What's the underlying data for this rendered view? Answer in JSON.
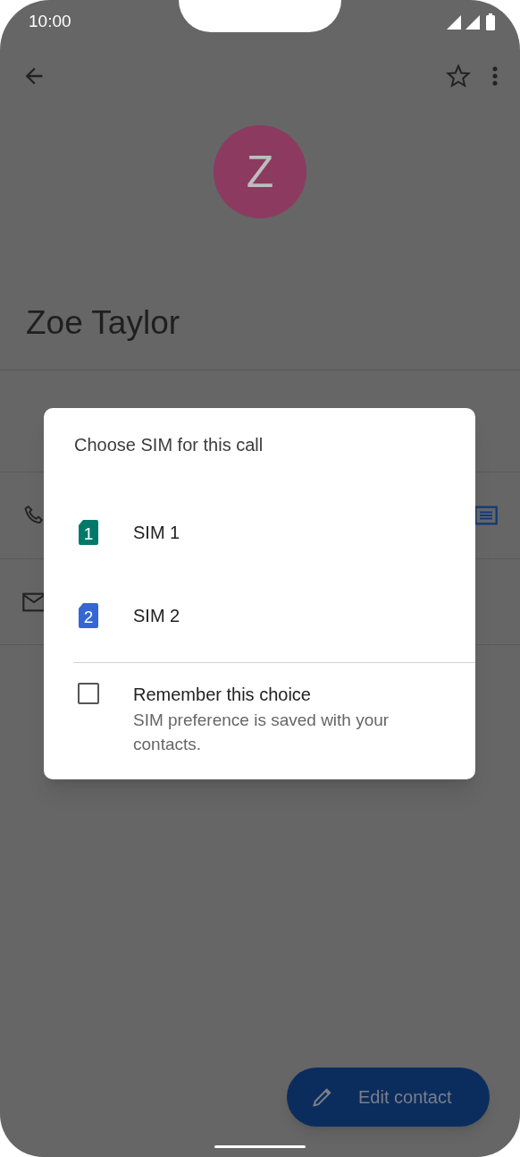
{
  "status_bar": {
    "time": "10:00"
  },
  "contact": {
    "avatar_letter": "Z",
    "name": "Zoe Taylor"
  },
  "dialog": {
    "title": "Choose SIM for this call",
    "sims": [
      {
        "badge": "1",
        "label": "SIM 1",
        "color": "#00796b"
      },
      {
        "badge": "2",
        "label": "SIM 2",
        "color": "#3367d6"
      }
    ],
    "remember": {
      "label": "Remember this choice",
      "description": "SIM preference is saved with your contacts.",
      "checked": false
    }
  },
  "fab": {
    "label": "Edit contact"
  }
}
